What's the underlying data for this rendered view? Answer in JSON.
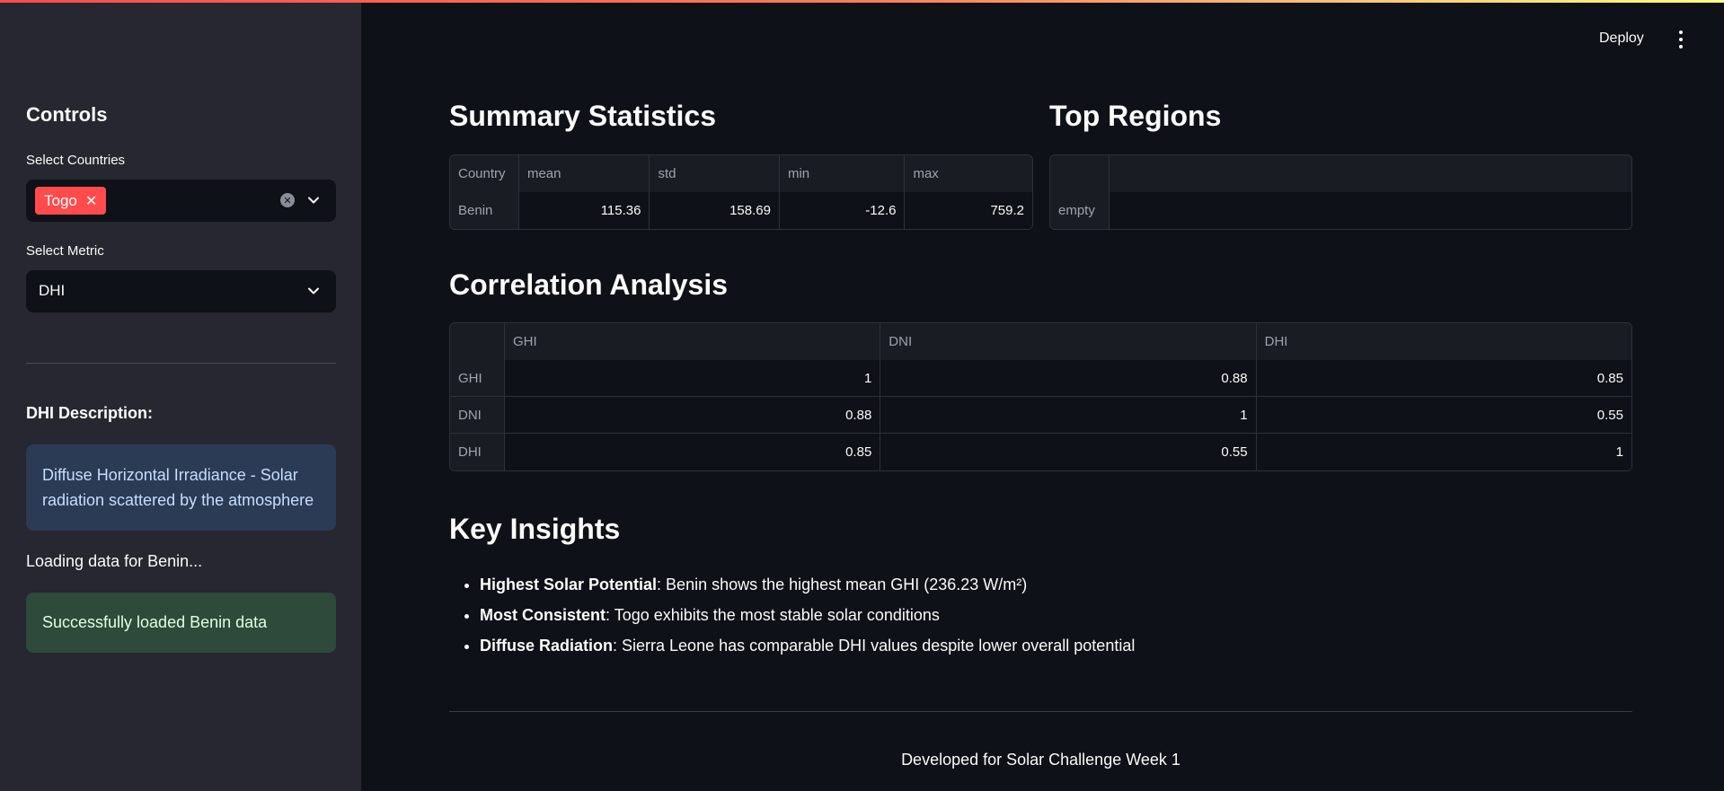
{
  "header": {
    "deploy_label": "Deploy"
  },
  "sidebar": {
    "title": "Controls",
    "countries": {
      "label": "Select Countries",
      "selected": [
        "Togo"
      ]
    },
    "metric": {
      "label": "Select Metric",
      "value": "DHI"
    },
    "description_title": "DHI Description:",
    "description_text": "Diffuse Horizontal Irradiance - Solar radiation scattered by the atmosphere",
    "loading_text": "Loading data for Benin...",
    "success_text": "Successfully loaded Benin data"
  },
  "summary": {
    "title": "Summary Statistics",
    "columns": [
      "Country",
      "mean",
      "std",
      "min",
      "max"
    ],
    "rows": [
      {
        "country": "Benin",
        "mean": "115.36",
        "std": "158.69",
        "min": "-12.6",
        "max": "759.2"
      }
    ]
  },
  "top_regions": {
    "title": "Top Regions",
    "empty_label": "empty"
  },
  "correlation": {
    "title": "Correlation Analysis",
    "columns": [
      "GHI",
      "DNI",
      "DHI"
    ],
    "rows": [
      {
        "label": "GHI",
        "values": [
          "1",
          "0.88",
          "0.85"
        ]
      },
      {
        "label": "DNI",
        "values": [
          "0.88",
          "1",
          "0.55"
        ]
      },
      {
        "label": "DHI",
        "values": [
          "0.85",
          "0.55",
          "1"
        ]
      }
    ]
  },
  "insights": {
    "title": "Key Insights",
    "items": [
      {
        "bold": "Highest Solar Potential",
        "text": ": Benin shows the highest mean GHI (236.23 W/m²)"
      },
      {
        "bold": "Most Consistent",
        "text": ": Togo exhibits the most stable solar conditions"
      },
      {
        "bold": "Diffuse Radiation",
        "text": ": Sierra Leone has comparable DHI values despite lower overall potential"
      }
    ]
  },
  "footer": {
    "text": "Developed for Solar Challenge Week 1"
  }
}
